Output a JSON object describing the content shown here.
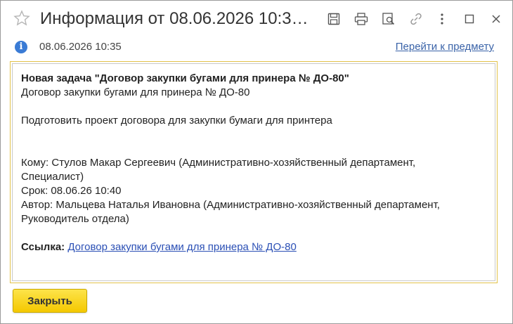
{
  "window": {
    "title": "Информация от 08.06.2026 10:35:...",
    "toolbar_icons": [
      "save-icon",
      "print-icon",
      "preview-icon",
      "link-icon",
      "more-icon",
      "maximize-icon",
      "close-icon"
    ]
  },
  "info": {
    "icon": "info-icon",
    "datetime": "08.06.2026 10:35",
    "goto_link": "Перейти к предмету"
  },
  "message": {
    "heading": "Новая задача \"Договор закупки бугами для принера № ДО-80\"",
    "subject": "Договор закупки бугами для принера № ДО-80",
    "description": "Подготовить проект договора для закупки бумаги для принтера",
    "to_line1": "Кому: Стулов Макар Сергеевич (Административно-хозяйственный департамент,",
    "to_line2": "Специалист)",
    "due": "Срок: 08.06.26 10:40",
    "author_line1": "Автор: Мальцева Наталья Ивановна (Административно-хозяйственный департамент,",
    "author_line2": "Руководитель отдела)",
    "link_label": "Ссылка:",
    "link_text": "Договор закупки бугами для принера № ДО-80"
  },
  "buttons": {
    "close": "Закрыть"
  },
  "colors": {
    "accent_button": "#f4c800",
    "frame_border": "#e2c24a",
    "link": "#3a63a8",
    "info_icon": "#3a7bd5"
  }
}
